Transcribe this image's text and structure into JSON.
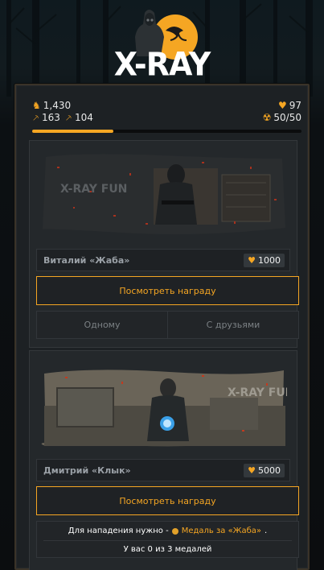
{
  "logo": {
    "text": "X-RAY"
  },
  "stats": {
    "trophies": "1,430",
    "pickaxe_a": "163",
    "pickaxe_b": "104",
    "hearts": "97",
    "radiation": "50/50",
    "progress": 0.3
  },
  "cards": [
    {
      "banner_text": "X-RAY FUN",
      "name": "Виталий «Жаба»",
      "price": "1000",
      "reward_button": "Посмотреть награду",
      "option_solo": "Одному",
      "option_friends": "С друзьями"
    },
    {
      "banner_text": "X-RAY FUN",
      "name": "Дмитрий «Клык»",
      "price": "5000",
      "reward_button": "Посмотреть награду",
      "requirement_prefix": "Для нападения нужно -",
      "requirement_medal": "Медаль за «Жаба»",
      "requirement_suffix": ".",
      "medal_count": "У вас 0 из 3 медалей"
    }
  ],
  "colors": {
    "accent": "#f5a623",
    "panel": "#1d2124",
    "card": "#24282b"
  },
  "icons": {
    "trophies": "trophy-icon",
    "pickaxe": "pickaxe-icon",
    "hearts": "heart-icon",
    "radiation": "radiation-icon",
    "medal": "medal-icon"
  }
}
